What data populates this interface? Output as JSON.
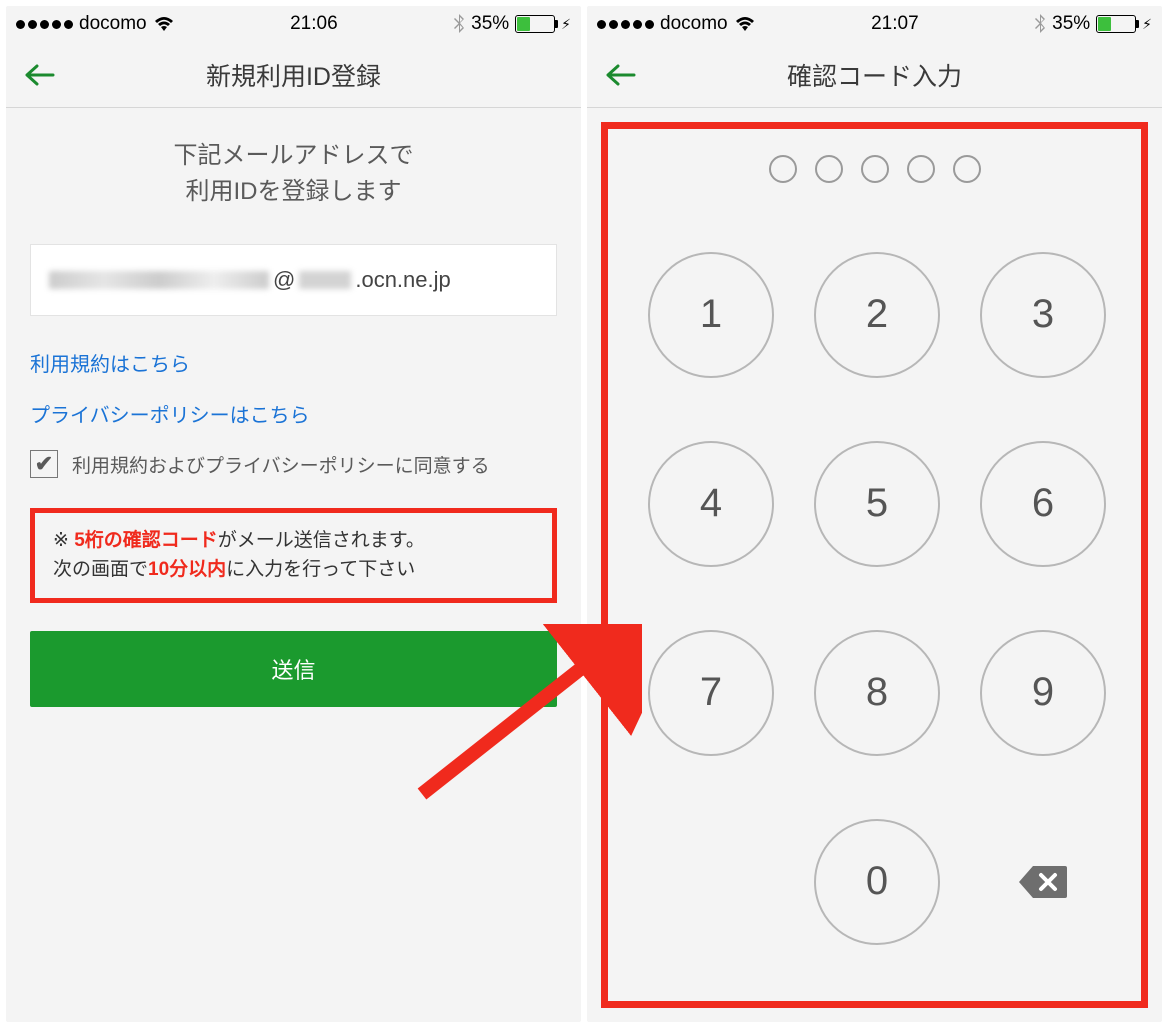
{
  "left": {
    "status": {
      "carrier": "docomo",
      "time": "21:06",
      "battery": "35%"
    },
    "nav_title": "新規利用ID登録",
    "heading_line1": "下記メールアドレスで",
    "heading_line2": "利用IDを登録します",
    "email_at": "@",
    "email_domain": ".ocn.ne.jp",
    "link_terms": "利用規約はこちら",
    "link_privacy": "プライバシーポリシーはこちら",
    "checkbox_checked": true,
    "agree_label": "利用規約およびプライバシーポリシーに同意する",
    "notice": {
      "prefix": "※ ",
      "red1": "5桁の確認コード",
      "mid1": "がメール送信されます。",
      "line2a": "次の画面で",
      "red2": "10分以内",
      "line2b": "に入力を行って下さい"
    },
    "submit": "送信"
  },
  "right": {
    "status": {
      "carrier": "docomo",
      "time": "21:07",
      "battery": "35%"
    },
    "nav_title": "確認コード入力",
    "pin_length": 5,
    "keys": [
      "1",
      "2",
      "3",
      "4",
      "5",
      "6",
      "7",
      "8",
      "9",
      "",
      "0",
      "⌫"
    ]
  }
}
